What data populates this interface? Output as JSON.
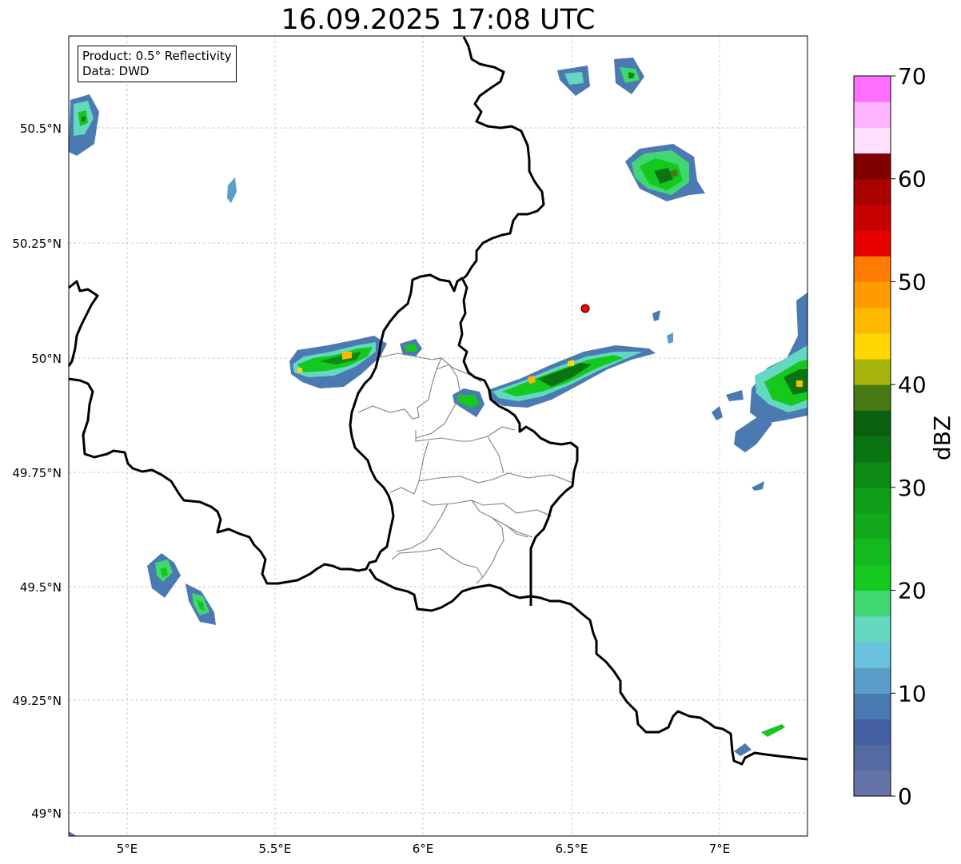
{
  "title": "16.09.2025 17:08 UTC",
  "info": {
    "product": "Product: 0.5° Reflectivity",
    "data": "Data: DWD"
  },
  "y_ticks": [
    "50.5°N",
    "50.25°N",
    "50°N",
    "49.75°N",
    "49.5°N",
    "49.25°N",
    "49°N"
  ],
  "x_ticks": [
    "5°E",
    "5.5°E",
    "6°E",
    "6.5°E",
    "7°E"
  ],
  "colorbar": {
    "label": "dBZ",
    "ticks": [
      "0",
      "10",
      "20",
      "30",
      "40",
      "50",
      "60",
      "70"
    ],
    "min": 0,
    "max": 70,
    "step": 2.5,
    "colors": [
      "#6473a8",
      "#566aa3",
      "#4560a2",
      "#4b7ab3",
      "#5b9ec9",
      "#69c3de",
      "#64d7c1",
      "#40d671",
      "#14c81e",
      "#12ba1f",
      "#11a91b",
      "#0f9c16",
      "#0d8a13",
      "#0b7412",
      "#0b5f10",
      "#477a12",
      "#aab30b",
      "#ffd600",
      "#ffb800",
      "#ff9b00",
      "#ff7d00",
      "#e70000",
      "#c70000",
      "#a90000",
      "#800000",
      "#ffe2ff",
      "#ffb4ff",
      "#ff6fff",
      "#e83be8"
    ]
  },
  "station_marker": {
    "lon": 6.55,
    "lat": 50.11,
    "color": "#ff0000"
  },
  "colors": {
    "border": "#000000",
    "districts": "#808080",
    "grid": "#b0b0b0"
  }
}
